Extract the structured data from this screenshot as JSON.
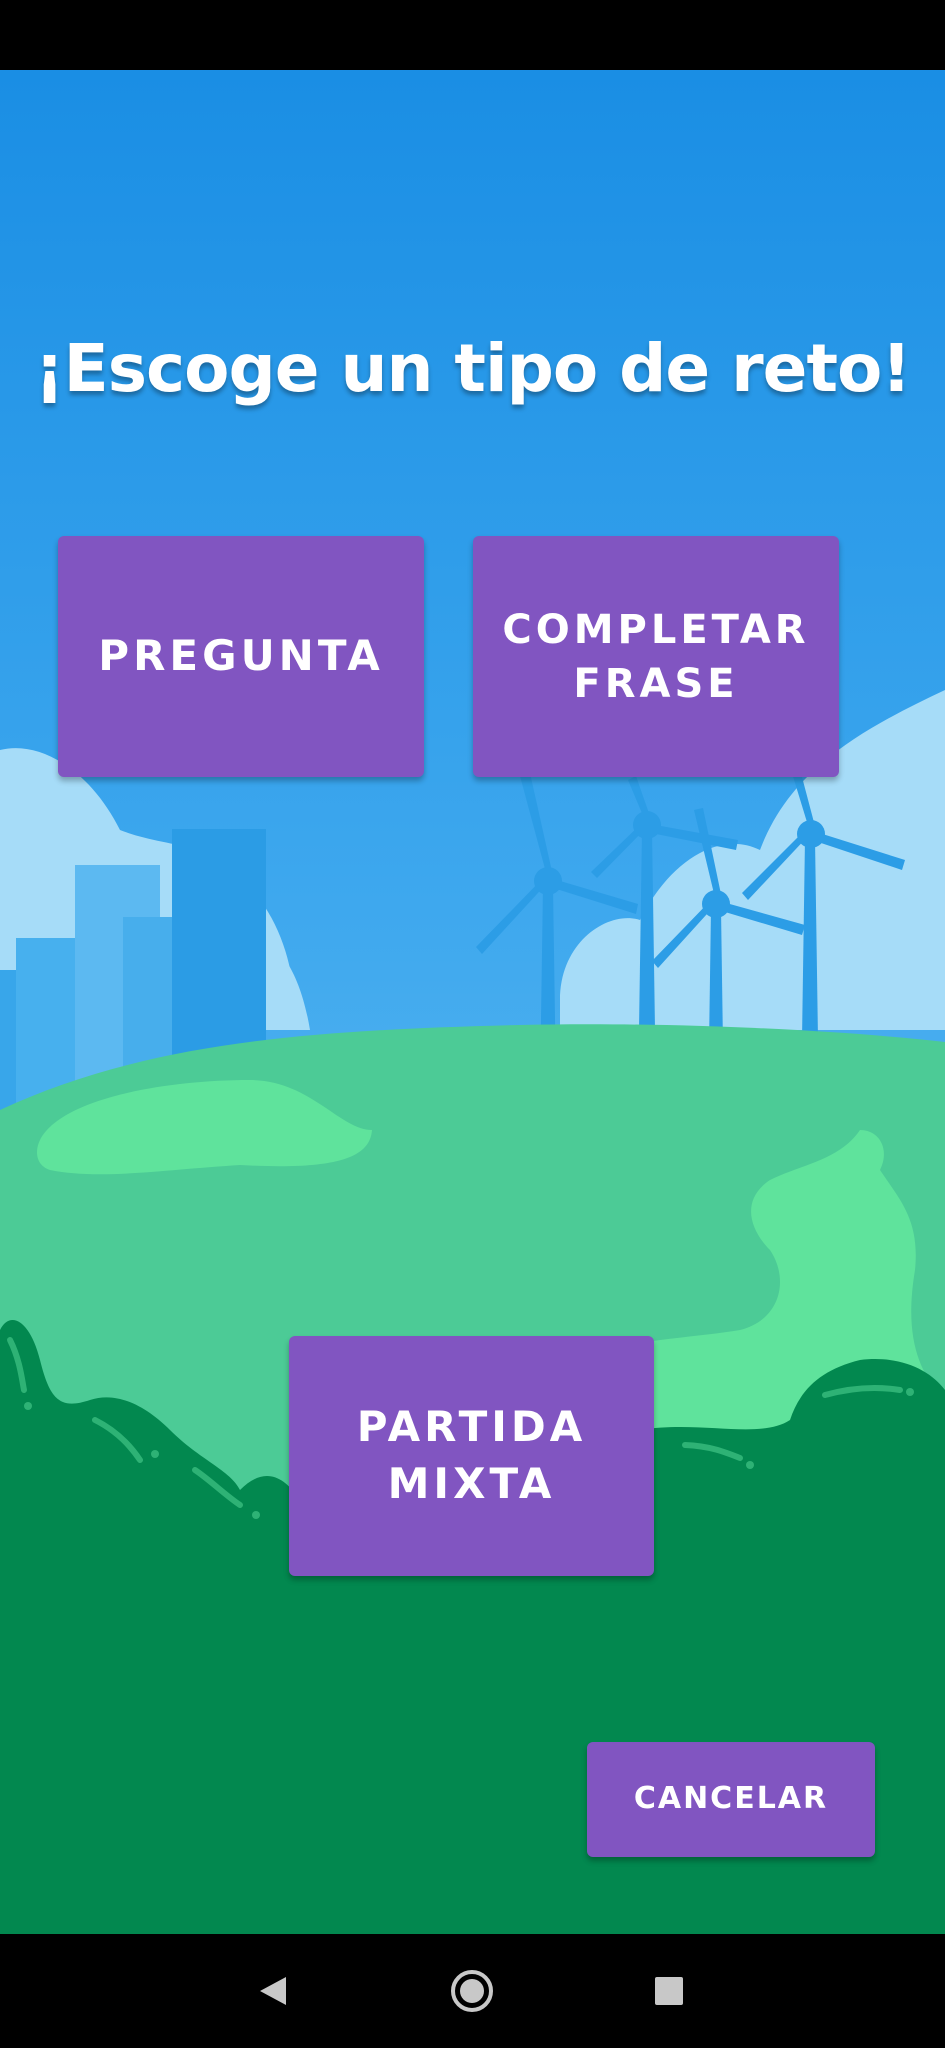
{
  "screen": {
    "title": "¡Escoge un tipo de reto!"
  },
  "buttons": {
    "pregunta": "PREGUNTA",
    "completar_frase": "COMPLETAR FRASE",
    "partida_mixta": "PARTIDA MIXTA",
    "cancelar": "CANCELAR"
  },
  "navigation": {
    "back_icon": "triangle-back-icon",
    "home_icon": "circle-home-icon",
    "recents_icon": "square-recents-icon"
  },
  "colors": {
    "sky_top": "#1a8ee4",
    "sky_bottom": "#8fd0f6",
    "button": "#8155c1",
    "hill": "#4ccb96",
    "hill_light": "#5fe39c",
    "bushes": "#02884f",
    "turbine": "#2c9de6",
    "buildings": "#38a6ea"
  }
}
